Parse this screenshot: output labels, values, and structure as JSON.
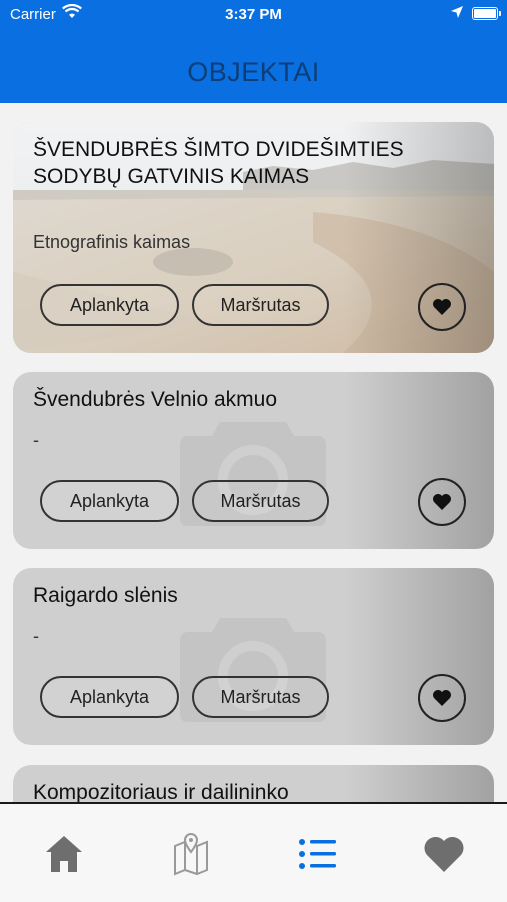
{
  "status_bar": {
    "carrier": "Carrier",
    "time": "3:37 PM"
  },
  "header": {
    "title": "OBJEKTAI"
  },
  "cards": [
    {
      "title": "ŠVENDUBRĖS ŠIMTO DVIDEŠIMTIES SODYBŲ GATVINIS KAIMAS",
      "subtitle": "Etnografinis kaimas",
      "visited_label": "Aplankyta",
      "route_label": "Maršrutas",
      "has_photo": true
    },
    {
      "title": "Švendubrės Velnio akmuo",
      "subtitle": "-",
      "visited_label": "Aplankyta",
      "route_label": "Maršrutas",
      "has_photo": false
    },
    {
      "title": "Raigardo slėnis",
      "subtitle": "-",
      "visited_label": "Aplankyta",
      "route_label": "Maršrutas",
      "has_photo": false
    },
    {
      "title": "Kompozitoriaus ir dailininko",
      "subtitle": "",
      "visited_label": "",
      "route_label": "",
      "has_photo": false
    }
  ],
  "tab_bar": {
    "items": [
      {
        "icon": "home-icon",
        "active": false
      },
      {
        "icon": "map-icon",
        "active": false
      },
      {
        "icon": "list-icon",
        "active": true
      },
      {
        "icon": "heart-icon",
        "active": false
      }
    ]
  },
  "colors": {
    "header": "#0a6fe0",
    "title": "#0d3e7a",
    "active_tab": "#0a6fe0",
    "inactive_tab": "#6e6e6e"
  }
}
